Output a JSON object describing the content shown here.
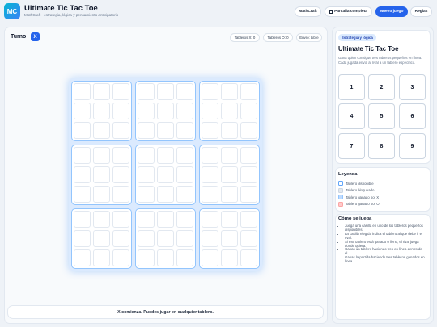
{
  "app": {
    "logo": "MC",
    "title": "Ultimate Tic Tac Toe",
    "subtitle": "MathCraft · estrategia, lógica y pensamiento anticipatorio"
  },
  "header": {
    "buttons": {
      "mathcraft": "MathCraft",
      "fullscreen": "Pantalla completa",
      "new_game": "Nuevo juego",
      "rules": "Reglas"
    }
  },
  "game": {
    "turn_label": "Turno",
    "current_player": "X",
    "boards_x": "Tableros X: 0",
    "boards_o": "Tableros O: 0",
    "send_to": "Envío: Libre",
    "status": "X comienza. Puedes jugar en cualquier tablero."
  },
  "sidebar": {
    "chip": "Estrategia y lógica",
    "title": "Ultimate Tic Tac Toe",
    "description": "Gana quien consigue tres tableros pequeños en línea. Cada jugada envía al rival a un tablero específico.",
    "mini_boards": [
      "1",
      "2",
      "3",
      "4",
      "5",
      "6",
      "7",
      "8",
      "9"
    ],
    "legend": {
      "title": "Leyenda",
      "items": [
        {
          "label": "Tablero disponible",
          "color": "#ffffff",
          "border": "#60a5fa"
        },
        {
          "label": "Tablero bloqueado",
          "color": "#e2e8f0",
          "border": "#cbd5e1"
        },
        {
          "label": "Tablero ganado por X",
          "color": "#bfdbfe",
          "border": "#93c5fd"
        },
        {
          "label": "Tablero ganado por O",
          "color": "#fecaca",
          "border": "#fca5a5"
        }
      ]
    },
    "howto": {
      "title": "Cómo se juega",
      "items": [
        "Juega una casilla en uno de los tableros pequeños disponibles.",
        "La casilla elegida indica el tablero al que debe ir el rival.",
        "Si ese tablero está ganado o lleno, el rival juega donde quiera.",
        "Ganas un tablero haciendo tres en línea dentro de él.",
        "Ganas la partida haciendo tres tableros ganados en línea."
      ]
    }
  },
  "colors": {
    "accent": "#2563eb",
    "board_border": "#93c5fd"
  }
}
